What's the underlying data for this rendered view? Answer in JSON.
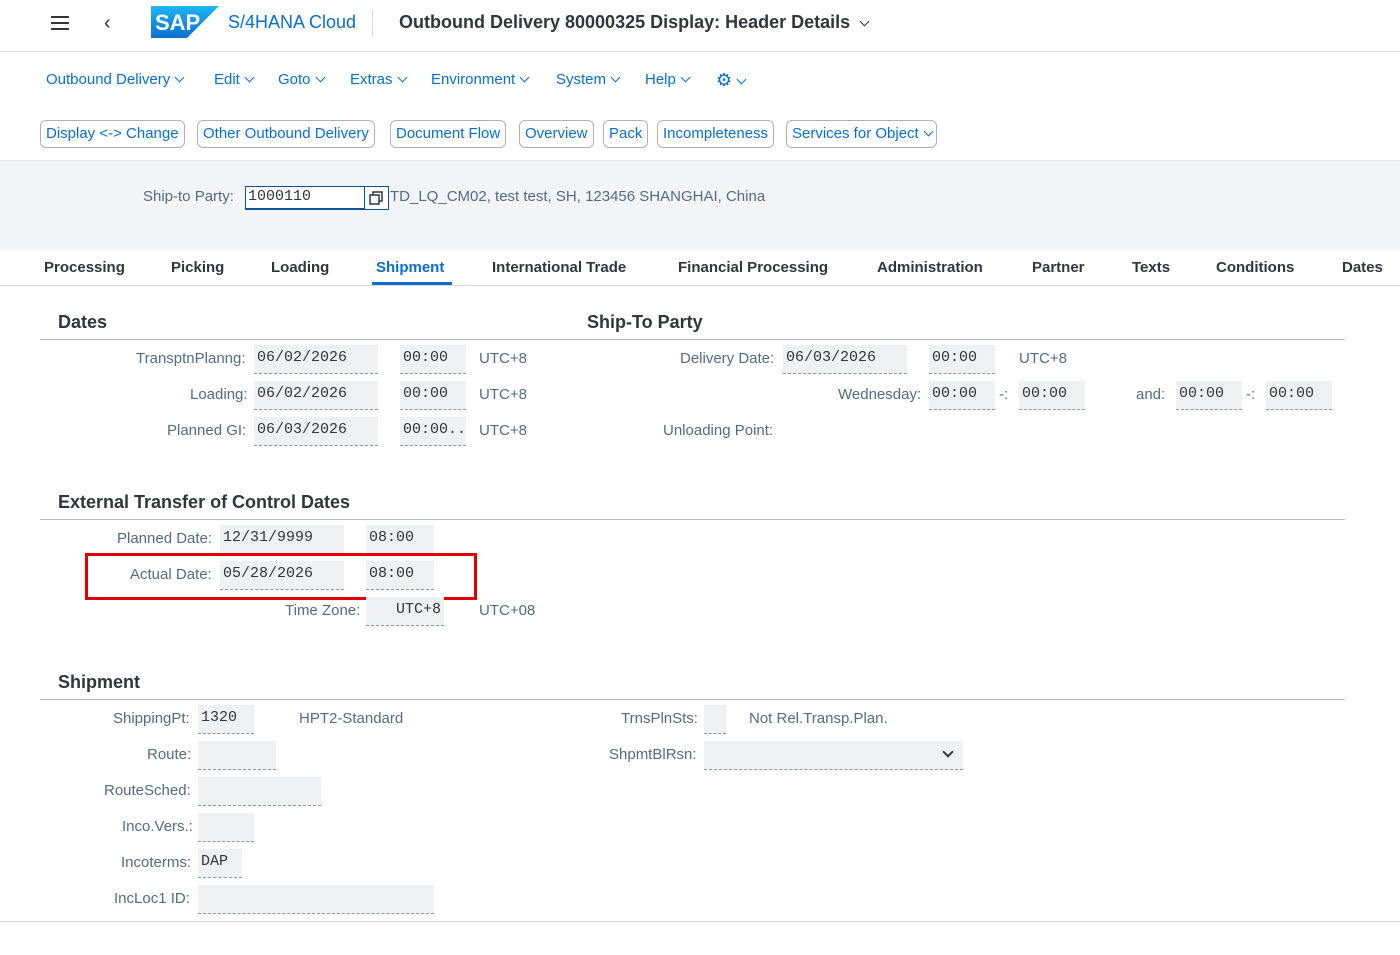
{
  "shell": {
    "product": "S/4HANA Cloud",
    "logo_text": "SAP",
    "title": "Outbound Delivery 80000325 Display: Header Details"
  },
  "menu": [
    "Outbound Delivery",
    "Edit",
    "Goto",
    "Extras",
    "Environment",
    "System",
    "Help"
  ],
  "buttons": [
    "Display <-> Change",
    "Other Outbound Delivery",
    "Document Flow",
    "Overview",
    "Pack",
    "Incompleteness",
    "Services for Object"
  ],
  "header": {
    "ship_to_label": "Ship-to Party:",
    "ship_to_value": "1000110",
    "ship_to_desc": "TD_LQ_CM02, test test, SH, 123456 SHANGHAI, China"
  },
  "tabs": [
    "Processing",
    "Picking",
    "Loading",
    "Shipment",
    "International Trade",
    "Financial Processing",
    "Administration",
    "Partner",
    "Texts",
    "Conditions",
    "Dates"
  ],
  "active_tab": "Shipment",
  "dates": {
    "title": "Dates",
    "transp_label": "TransptnPlanng:",
    "transp_date": "06/02/2026",
    "transp_time": "00:00",
    "transp_tz": "UTC+8",
    "loading_label": "Loading:",
    "loading_date": "06/02/2026",
    "loading_time": "00:00",
    "loading_tz": "UTC+8",
    "gi_label": "Planned GI:",
    "gi_date": "06/03/2026",
    "gi_time": "00:00...",
    "gi_tz": "UTC+8"
  },
  "shipto": {
    "title": "Ship-To Party",
    "delivery_label": "Delivery Date:",
    "delivery_date": "06/03/2026",
    "delivery_time": "00:00",
    "delivery_tz": "UTC+8",
    "wed_label": "Wednesday:",
    "wed_from": "00:00",
    "dash1": "-:",
    "wed_to": "00:00",
    "and_label": "and:",
    "and_from": "00:00",
    "dash2": "-:",
    "and_to": "00:00",
    "unloading_label": "Unloading Point:"
  },
  "transfer": {
    "title": "External Transfer of Control Dates",
    "planned_label": "Planned Date:",
    "planned_date": "12/31/9999",
    "planned_time": "08:00",
    "actual_label": "Actual Date:",
    "actual_date": "05/28/2026",
    "actual_time": "08:00",
    "tz_label": "Time Zone:",
    "tz_value": "UTC+8",
    "tz_desc": "UTC+08"
  },
  "shipment": {
    "title": "Shipment",
    "shippingpt_label": "ShippingPt:",
    "shippingpt_value": "1320",
    "shippingpt_desc": "HPT2-Standard",
    "route_label": "Route:",
    "route_value": "",
    "routesched_label": "RouteSched:",
    "routesched_value": "",
    "incovers_label": "Inco.Vers.:",
    "incovers_value": "",
    "incoterms_label": "Incoterms:",
    "incoterms_value": "DAP",
    "incloc_label": "IncLoc1 ID:",
    "incloc_value": "",
    "trnsplnsts_label": "TrnsPlnSts:",
    "trnsplnsts_value": "",
    "trnsplnsts_desc": "Not Rel.Transp.Plan.",
    "shpmtblrsn_label": "ShpmtBlRsn:",
    "shpmtblrsn_value": ""
  },
  "colors": {
    "accent": "#0a6ed1",
    "highlight": "#e00000"
  }
}
